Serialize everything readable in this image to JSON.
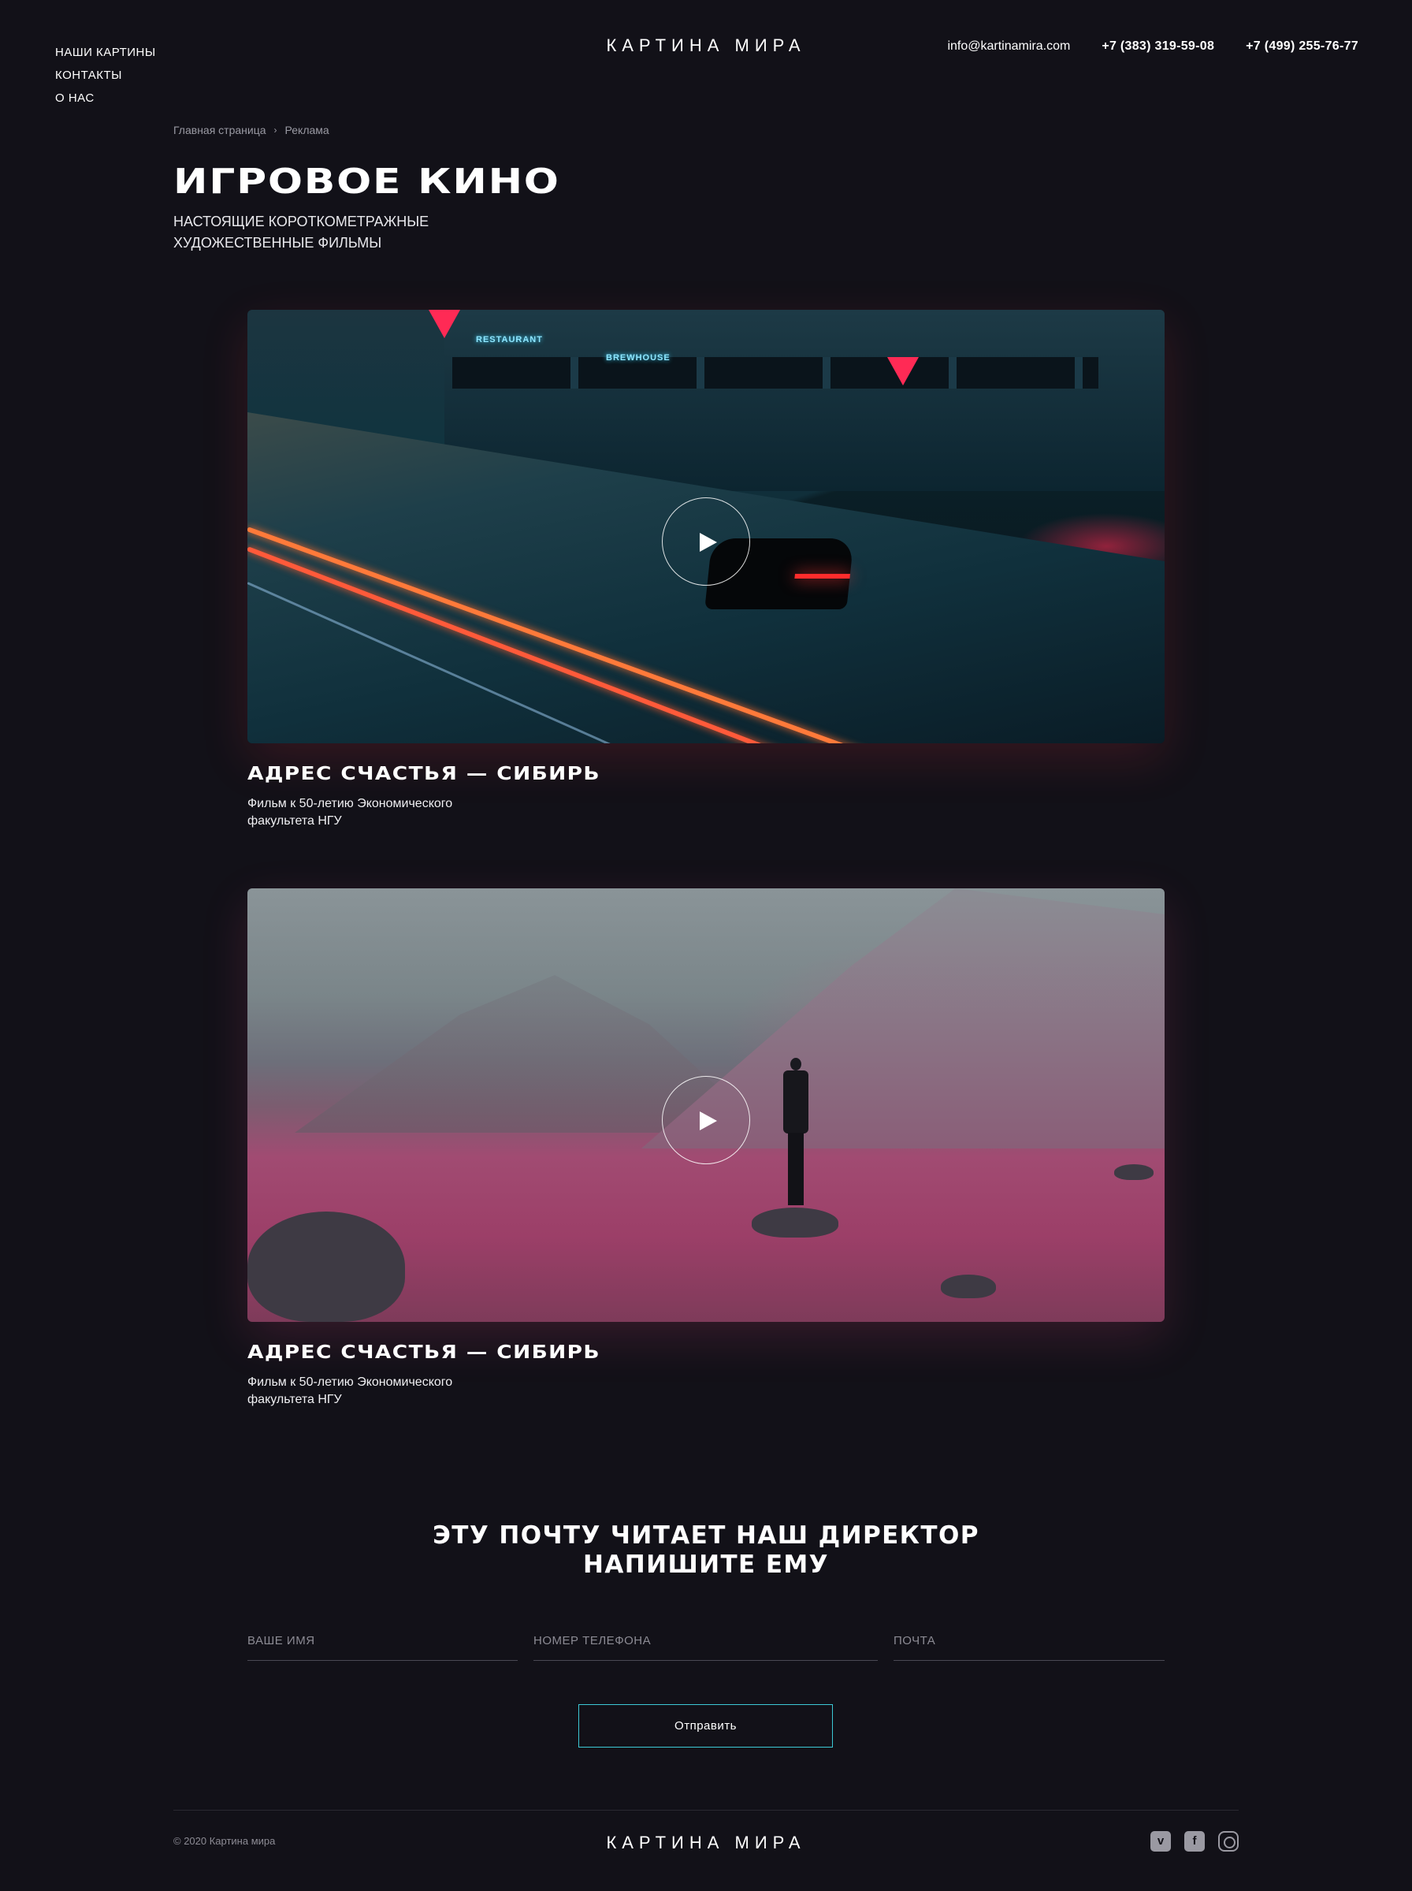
{
  "header": {
    "nav": [
      "НАШИ КАРТИНЫ",
      "КОНТАКТЫ",
      "О НАС"
    ],
    "logo": "КАРТИНА МИРА",
    "email": "info@kartinamira.com",
    "phone1": "+7 (383) 319-59-08",
    "phone2": "+7 (499) 255-76-77"
  },
  "breadcrumb": {
    "home": "Главная страница",
    "separator": "›",
    "current": "Реклама"
  },
  "page": {
    "title": "ИГРОВОЕ КИНО",
    "subtitle": "НАСТОЯЩИЕ КОРОТКОМЕТРАЖНЫЕ ХУДОЖЕСТВЕННЫЕ ФИЛЬМЫ"
  },
  "films": [
    {
      "title": "АДРЕС СЧАСТЬЯ — СИБИРЬ",
      "description": "Фильм к 50-летию Экономического факультета НГУ",
      "image": "night-city-car",
      "signs": [
        "RESTAURANT",
        "BREWHOUSE"
      ]
    },
    {
      "title": "АДРЕС СЧАСТЬЯ — СИБИРЬ",
      "description": "Фильм к 50-летию Экономического факультета НГУ",
      "image": "pink-mountain-valley"
    }
  ],
  "contact": {
    "title_line1": "ЭТУ ПОЧТУ ЧИТАЕТ НАШ ДИРЕКТОР",
    "title_line2": "НАПИШИТЕ ЕМУ",
    "name_placeholder": "ВАШЕ ИМЯ",
    "phone_placeholder": "НОМЕР ТЕЛЕФОНА",
    "email_placeholder": "ПОЧТА",
    "submit": "Отправить"
  },
  "footer": {
    "copyright": "© 2020 Картина мира",
    "logo": "КАРТИНА МИРА",
    "socials": [
      "vimeo-icon",
      "facebook-icon",
      "instagram-icon"
    ]
  },
  "colors": {
    "background": "#121118",
    "accent": "#3cc9d6",
    "text": "#ffffff",
    "muted": "#8c8b94"
  }
}
